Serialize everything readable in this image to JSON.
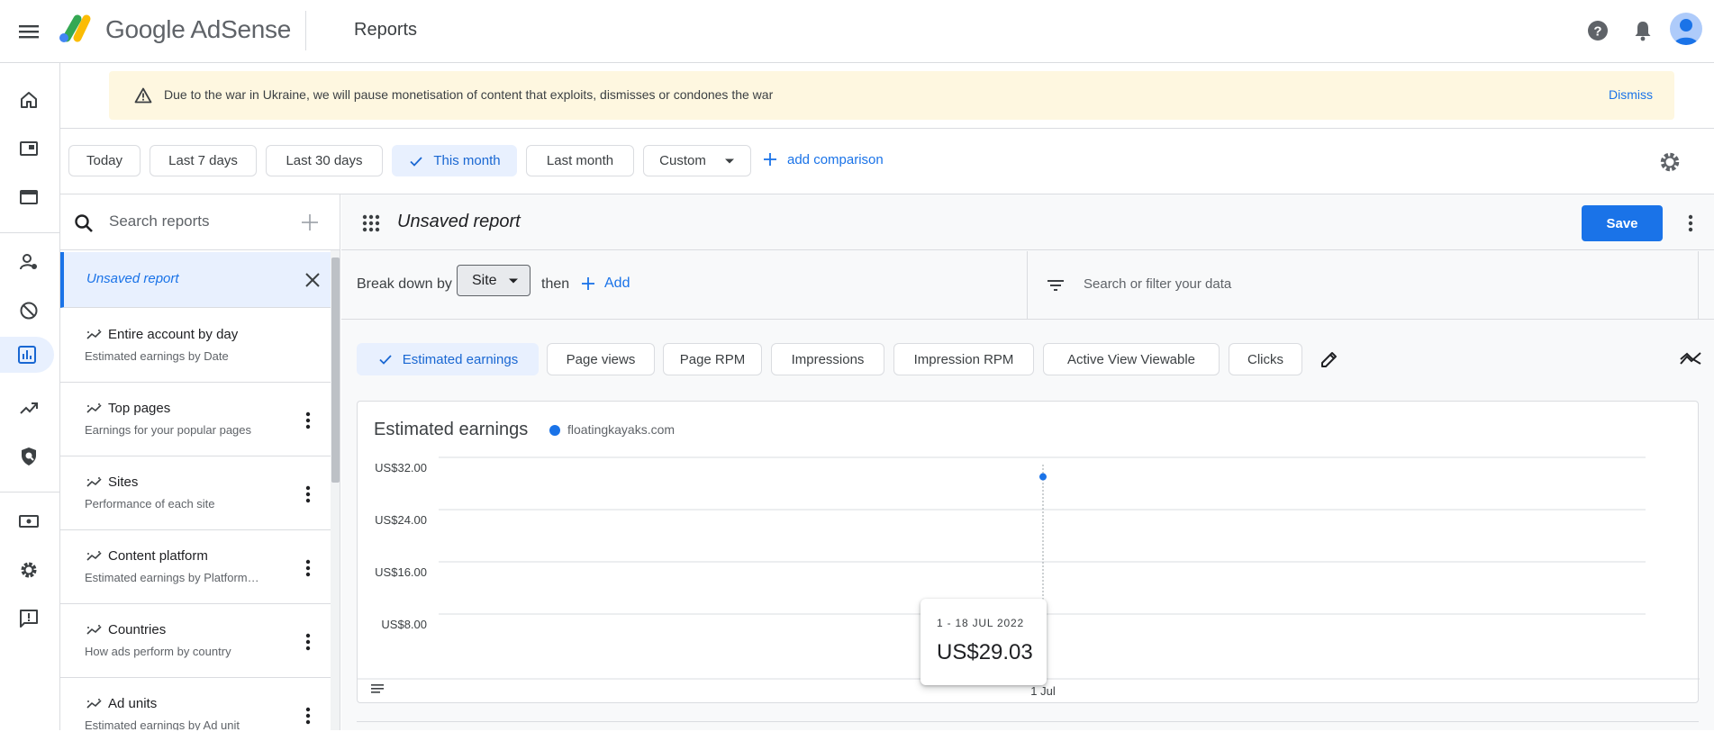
{
  "app": {
    "logo_text": "Google AdSense",
    "page_title": "Reports"
  },
  "header_icons": [
    "menu-icon",
    "help-icon",
    "notifications-icon",
    "account-icon"
  ],
  "rail": {
    "items": [
      "home-icon",
      "sites-icon",
      "ads-icon",
      "privacy-messaging-icon",
      "blocking-controls-icon",
      "reports-icon",
      "optimization-icon",
      "brand-safety-icon",
      "payments-icon",
      "settings-icon",
      "feedback-icon"
    ],
    "active": "reports-icon"
  },
  "banner": {
    "text": "Due to the war in Ukraine, we will pause monetisation of content that exploits, dismisses or condones the war",
    "dismiss": "Dismiss"
  },
  "date_filters": {
    "chips": [
      "Today",
      "Last 7 days",
      "Last 30 days",
      "This month",
      "Last month",
      "Custom"
    ],
    "selected": "This month",
    "add_comparison": "add comparison"
  },
  "reports_panel": {
    "search_placeholder": "Search reports",
    "unsaved": "Unsaved report",
    "items": [
      {
        "title": "Entire account by day",
        "subtitle": "Estimated earnings by Date"
      },
      {
        "title": "Top pages",
        "subtitle": "Earnings for your popular pages"
      },
      {
        "title": "Sites",
        "subtitle": "Performance of each site"
      },
      {
        "title": "Content platform",
        "subtitle": "Estimated earnings by Platform…"
      },
      {
        "title": "Countries",
        "subtitle": "How ads perform by country"
      },
      {
        "title": "Ad units",
        "subtitle": "Estimated earnings by Ad unit"
      }
    ]
  },
  "report": {
    "title": "Unsaved report",
    "save": "Save",
    "breakdown_label": "Break down by",
    "breakdown_value": "Site",
    "then": "then",
    "add": "Add",
    "filter_placeholder": "Search or filter your data",
    "metrics": [
      "Estimated earnings",
      "Page views",
      "Page RPM",
      "Impressions",
      "Impression RPM",
      "Active View Viewable",
      "Clicks"
    ],
    "selected_metric": "Estimated earnings"
  },
  "chart": {
    "title": "Estimated earnings",
    "legend": "floatingkayaks.com",
    "series_color": "#1a73e8",
    "tooltip_date": "1 - 18 JUL 2022",
    "tooltip_value": "US$29.03"
  },
  "chart_data": {
    "type": "line",
    "title": "Estimated earnings",
    "x": [
      "1 Jul"
    ],
    "series": [
      {
        "name": "floatingkayaks.com",
        "values": [
          29.03
        ]
      }
    ],
    "ytick_labels": [
      "US$32.00",
      "US$24.00",
      "US$16.00",
      "US$8.00"
    ],
    "yticks": [
      32,
      24,
      16,
      8
    ],
    "ylim": [
      0,
      32
    ],
    "grid": true,
    "legend": "top-left"
  }
}
